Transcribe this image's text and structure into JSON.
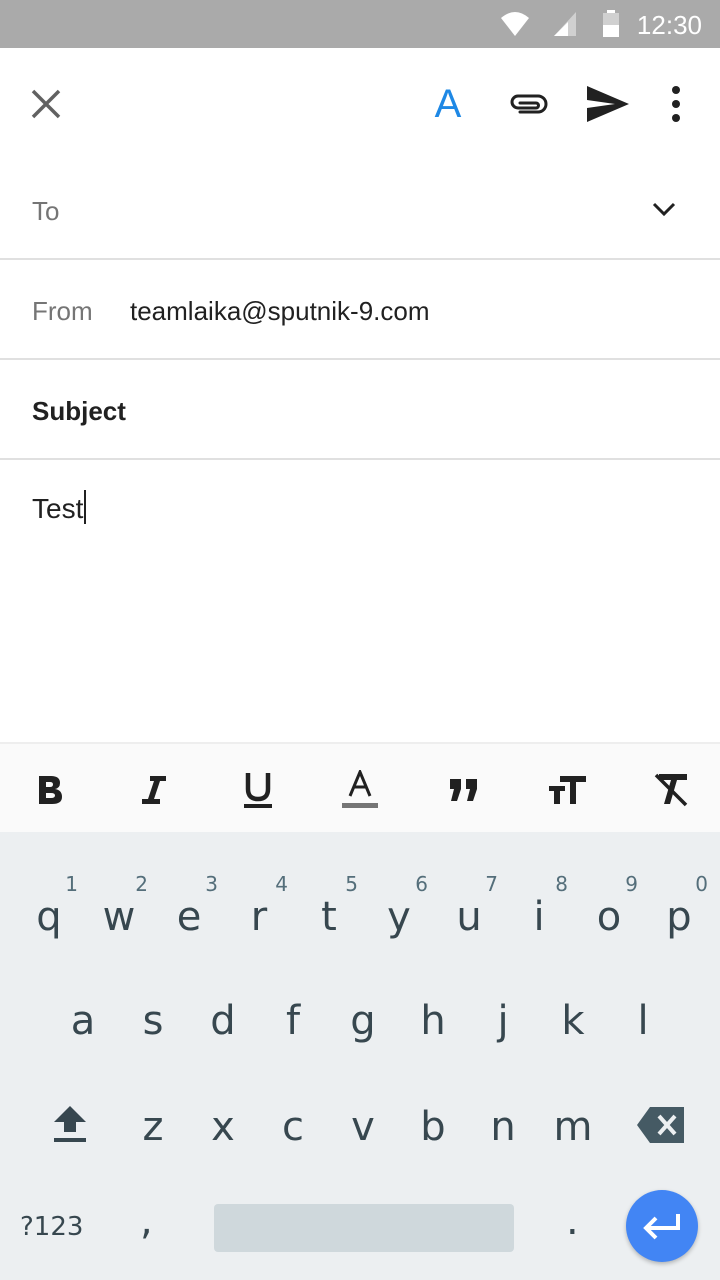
{
  "status_bar": {
    "time": "12:30",
    "icons": [
      "wifi-icon",
      "cell-signal-icon",
      "battery-icon"
    ]
  },
  "toolbar": {
    "close_icon": "close-icon",
    "format_label": "A",
    "attach_icon": "paperclip-icon",
    "send_icon": "send-icon",
    "more_icon": "more-vert-icon"
  },
  "compose": {
    "to_label": "To",
    "from_label": "From",
    "from_value": "teamlaika@sputnik-9.com",
    "subject_label": "Subject",
    "body": "Test"
  },
  "format_bar": {
    "items": [
      "bold-icon",
      "italic-icon",
      "underline-icon",
      "text-color-icon",
      "quote-icon",
      "text-size-icon",
      "clear-format-icon"
    ]
  },
  "keyboard": {
    "row1": [
      {
        "key": "q",
        "hint": "1"
      },
      {
        "key": "w",
        "hint": "2"
      },
      {
        "key": "e",
        "hint": "3"
      },
      {
        "key": "r",
        "hint": "4"
      },
      {
        "key": "t",
        "hint": "5"
      },
      {
        "key": "y",
        "hint": "6"
      },
      {
        "key": "u",
        "hint": "7"
      },
      {
        "key": "i",
        "hint": "8"
      },
      {
        "key": "o",
        "hint": "9"
      },
      {
        "key": "p",
        "hint": "0"
      }
    ],
    "row2": [
      "a",
      "s",
      "d",
      "f",
      "g",
      "h",
      "j",
      "k",
      "l"
    ],
    "row3": [
      "z",
      "x",
      "c",
      "v",
      "b",
      "n",
      "m"
    ],
    "symbols_label": "?123",
    "comma": ",",
    "period": "."
  }
}
